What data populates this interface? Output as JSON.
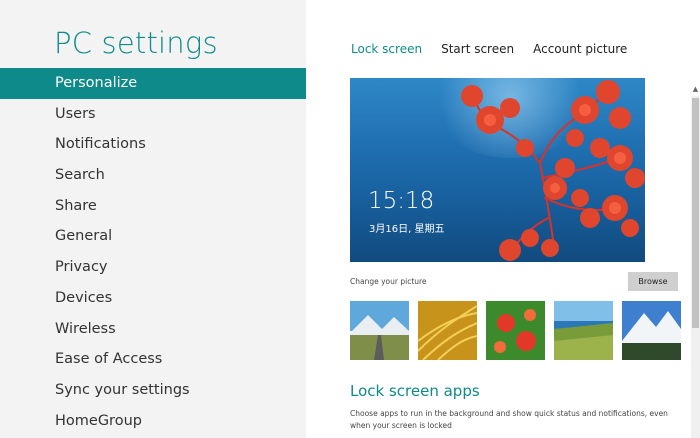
{
  "app": {
    "title": "PC settings"
  },
  "nav": {
    "items": [
      {
        "label": "Personalize"
      },
      {
        "label": "Users"
      },
      {
        "label": "Notifications"
      },
      {
        "label": "Search"
      },
      {
        "label": "Share"
      },
      {
        "label": "General"
      },
      {
        "label": "Privacy"
      },
      {
        "label": "Devices"
      },
      {
        "label": "Wireless"
      },
      {
        "label": "Ease of Access"
      },
      {
        "label": "Sync your settings"
      },
      {
        "label": "HomeGroup"
      }
    ],
    "selected": "Personalize"
  },
  "tabs": {
    "items": [
      {
        "label": "Lock screen"
      },
      {
        "label": "Start screen"
      },
      {
        "label": "Account picture"
      }
    ],
    "selected": "Lock screen"
  },
  "preview": {
    "time": "15:18",
    "date": "3月16日, 星期五"
  },
  "picture": {
    "change_label": "Change your picture",
    "browse_label": "Browse",
    "thumbnails": [
      {
        "icon": "road-mountain-thumbnail"
      },
      {
        "icon": "golden-grass-thumbnail"
      },
      {
        "icon": "red-flower-thumbnail"
      },
      {
        "icon": "green-coast-thumbnail"
      },
      {
        "icon": "snowy-mountain-thumbnail"
      }
    ]
  },
  "lock_apps": {
    "title": "Lock screen apps",
    "description": "Choose apps to run in the background and show quick status and notifications, even when your screen is locked"
  },
  "colors": {
    "accent": "#0f8a8a",
    "left_panel": "#f3f3f3"
  }
}
